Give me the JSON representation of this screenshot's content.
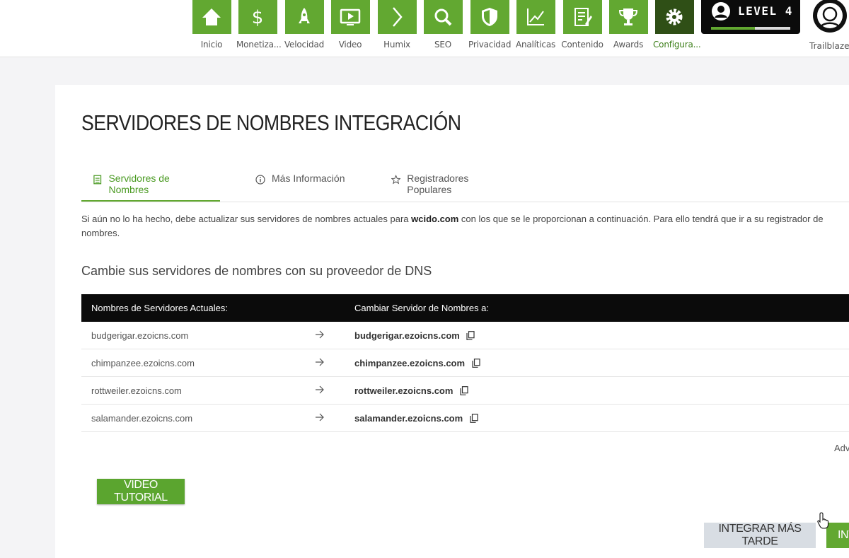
{
  "nav": {
    "items": [
      {
        "label": "Inicio",
        "icon": "home-icon"
      },
      {
        "label": "Monetiza...",
        "icon": "dollar-icon"
      },
      {
        "label": "Velocidad",
        "icon": "rocket-icon"
      },
      {
        "label": "Video",
        "icon": "video-icon"
      },
      {
        "label": "Humix",
        "icon": "chevron-right-icon"
      },
      {
        "label": "SEO",
        "icon": "magnifier-icon"
      },
      {
        "label": "Privacidad",
        "icon": "shield-icon"
      },
      {
        "label": "Analíticas",
        "icon": "line-chart-icon"
      },
      {
        "label": "Contenido",
        "icon": "document-edit-icon"
      },
      {
        "label": "Awards",
        "icon": "trophy-icon"
      },
      {
        "label": "Configura...",
        "icon": "gear-icon"
      }
    ],
    "active_index": 10,
    "level": {
      "text": "LEVEL 4",
      "progress": 0.55
    },
    "profile_label": "Trailblazer"
  },
  "colors": {
    "brand_green": "#62a831",
    "active_tile": "#2f4f16",
    "header_black": "#0b0b0b"
  },
  "page": {
    "title": "SERVIDORES DE NOMBRES INTEGRACIÓN",
    "tabs": [
      {
        "label": "Servidores de Nombres",
        "icon": "list-icon",
        "active": true
      },
      {
        "label": "Más Información",
        "icon": "info-icon",
        "active": false
      },
      {
        "label": "Registradores Populares",
        "icon": "star-icon",
        "active": false
      }
    ],
    "intro_prefix": "Si aún no lo ha hecho, debe actualizar sus servidores de nombres actuales para ",
    "intro_domain": "wcido.com",
    "intro_suffix": " con los que se le proporcionan a continuación. Para ello tendrá que ir a su registrador de nombres.",
    "subtitle": "Cambie sus servidores de nombres con su proveedor de DNS",
    "table": {
      "headers": [
        "Nombres de Servidores Actuales:",
        "Cambiar Servidor de Nombres a:"
      ],
      "rows": [
        {
          "current": "budgerigar.ezoicns.com",
          "new": "budgerigar.ezoicns.com"
        },
        {
          "current": "chimpanzee.ezoicns.com",
          "new": "chimpanzee.ezoicns.com"
        },
        {
          "current": "rottweiler.ezoicns.com",
          "new": "rottweiler.ezoicns.com"
        },
        {
          "current": "salamander.ezoicns.com",
          "new": "salamander.ezoicns.com"
        }
      ]
    },
    "advanced_link": "Adv",
    "buttons": {
      "video_tutorial": "VIDEO TUTORIAL",
      "integrate_later": "INTEGRAR MÁS TARDE",
      "integrate_now": "INT"
    }
  }
}
